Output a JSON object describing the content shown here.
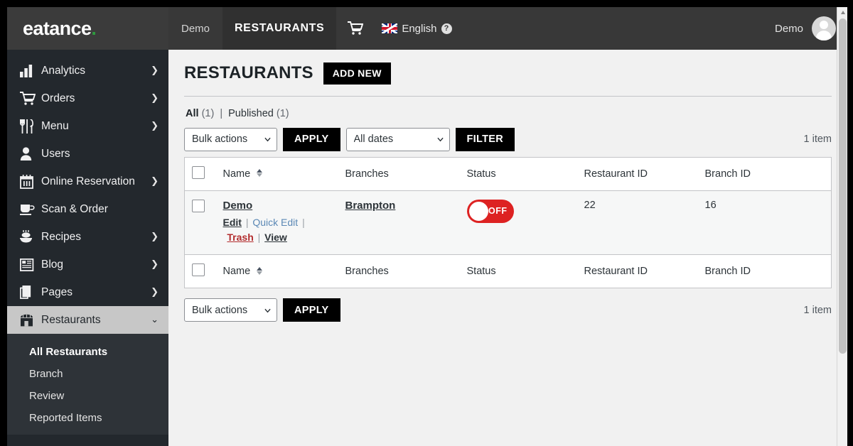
{
  "topbar": {
    "logo_text": "eatance",
    "logo_dot": ".",
    "site_name": "Demo",
    "active_section": "RESTAURANTS",
    "cart_icon": "shopping-cart-icon",
    "language": "English",
    "help_icon": "help-question-icon",
    "user_name": "Demo",
    "avatar_icon": "user-avatar-icon"
  },
  "sidebar": {
    "items": [
      {
        "label": "Analytics",
        "icon": "bar-chart-icon",
        "has_submenu": true
      },
      {
        "label": "Orders",
        "icon": "shopping-cart-icon",
        "has_submenu": true
      },
      {
        "label": "Menu",
        "icon": "fork-knife-icon",
        "has_submenu": true
      },
      {
        "label": "Users",
        "icon": "user-icon",
        "has_submenu": false
      },
      {
        "label": "Online Reservation",
        "icon": "calendar-icon",
        "has_submenu": true
      },
      {
        "label": "Scan & Order",
        "icon": "coffee-cup-icon",
        "has_submenu": false
      },
      {
        "label": "Recipes",
        "icon": "cake-icon",
        "has_submenu": true
      },
      {
        "label": "Blog",
        "icon": "newspaper-icon",
        "has_submenu": true
      },
      {
        "label": "Pages",
        "icon": "pages-icon",
        "has_submenu": true
      },
      {
        "label": "Restaurants",
        "icon": "storefront-icon",
        "has_submenu": true,
        "active": true
      }
    ],
    "submenu": [
      {
        "label": "All Restaurants",
        "current": true
      },
      {
        "label": "Branch",
        "current": false
      },
      {
        "label": "Review",
        "current": false
      },
      {
        "label": "Reported Items",
        "current": false
      }
    ]
  },
  "page": {
    "title": "RESTAURANTS",
    "add_new_label": "ADD NEW"
  },
  "views": {
    "all_label": "All",
    "all_count": "(1)",
    "separator": "|",
    "published_label": "Published",
    "published_count": "(1)"
  },
  "tablenav_top": {
    "bulk_actions_value": "Bulk actions",
    "apply_label": "APPLY",
    "dates_value": "All dates",
    "filter_label": "FILTER",
    "item_count": "1 item"
  },
  "tablenav_bottom": {
    "bulk_actions_value": "Bulk actions",
    "apply_label": "APPLY",
    "item_count": "1 item"
  },
  "table": {
    "columns": [
      "Name",
      "Branches",
      "Status",
      "Restaurant ID",
      "Branch ID"
    ],
    "sortable_column": "Name",
    "rows": [
      {
        "name": "Demo",
        "actions": {
          "edit": "Edit",
          "quick_edit": "Quick Edit",
          "trash": "Trash",
          "view": "View"
        },
        "branches": "Brampton",
        "status_state": "OFF",
        "status_on": false,
        "restaurant_id": "22",
        "branch_id": "16"
      }
    ]
  },
  "colors": {
    "brand_dot": "#2e9b3e",
    "topbar_bg": "#383838",
    "sidebar_bg": "#23282d",
    "accent_black": "#000000",
    "toggle_off": "#dd2222",
    "link_blue": "#2271b1",
    "trash_red": "#b32d2e"
  }
}
